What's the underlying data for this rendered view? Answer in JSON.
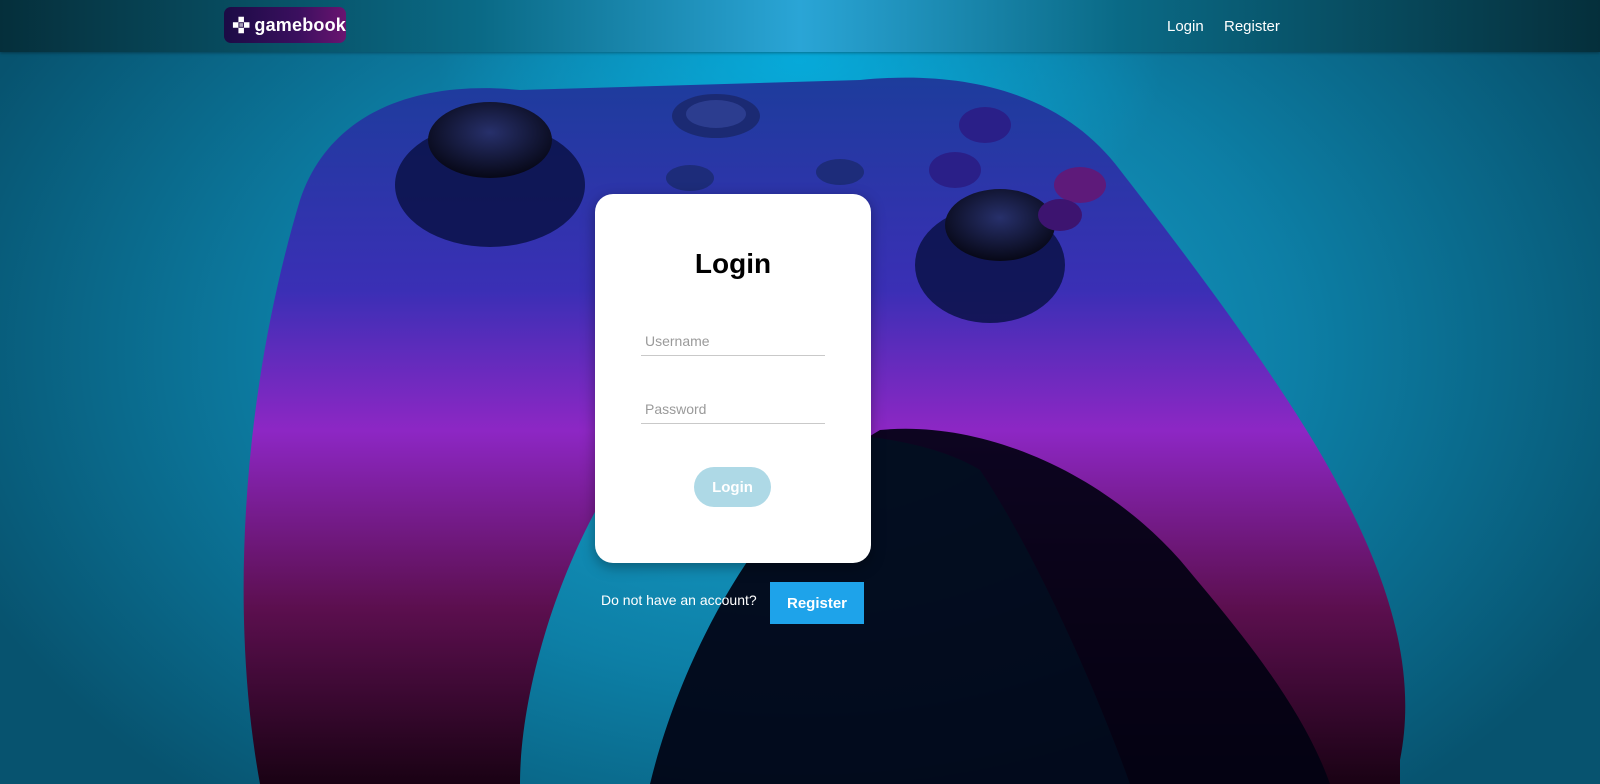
{
  "header": {
    "logo_text": "gamebook",
    "nav": {
      "login": "Login",
      "register": "Register"
    }
  },
  "login_card": {
    "title": "Login",
    "username_placeholder": "Username",
    "password_placeholder": "Password",
    "submit_label": "Login"
  },
  "register_prompt": {
    "text": "Do not have an account?",
    "button_label": "Register"
  },
  "colors": {
    "header_accent": "#2aa5d6",
    "logo_bg": "#3a0f5e",
    "login_button_disabled": "#aed9e6",
    "register_button": "#1ea3ea"
  }
}
